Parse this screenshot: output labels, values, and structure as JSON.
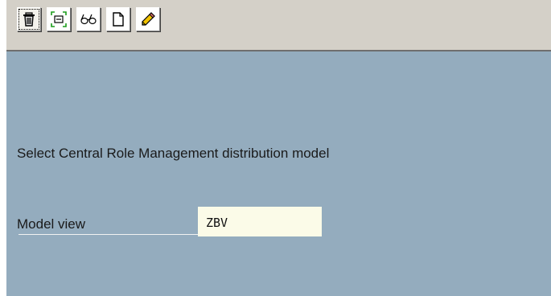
{
  "toolbar": {
    "buttons": [
      {
        "icon": "trash-icon",
        "selected": true
      },
      {
        "icon": "fit-screen-icon",
        "selected": false
      },
      {
        "icon": "glasses-icon",
        "selected": false
      },
      {
        "icon": "new-document-icon",
        "selected": false
      },
      {
        "icon": "pencil-icon",
        "selected": false
      }
    ]
  },
  "main": {
    "heading": "Select Central Role Management distribution model",
    "fields": [
      {
        "label": "Model view",
        "value": "ZBV"
      }
    ]
  },
  "colors": {
    "toolbar_bg": "#d4d0c8",
    "main_bg": "#94acbe",
    "input_bg": "#fbfbe8",
    "text": "#1a1a1a"
  }
}
